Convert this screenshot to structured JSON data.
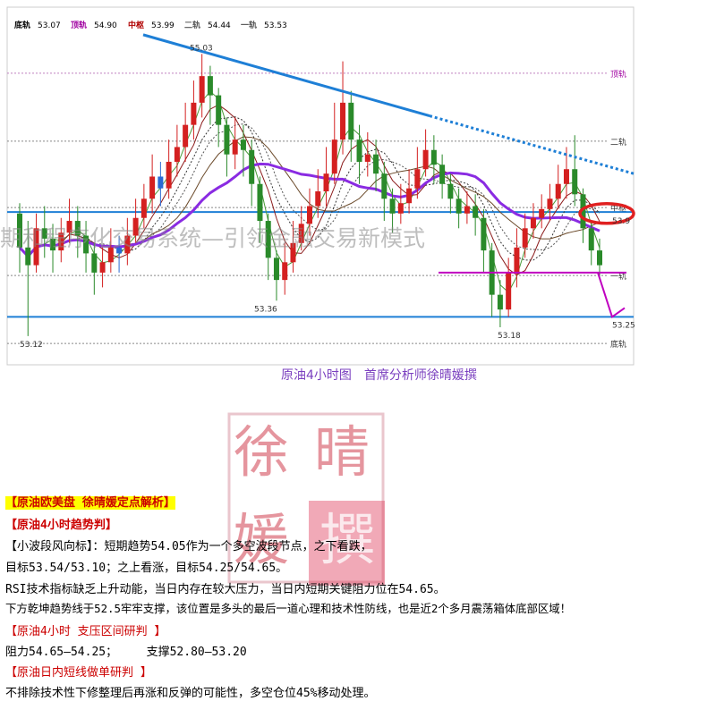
{
  "chart_data": {
    "type": "candlestick",
    "title": "原油4小时图　首席分析师徐晴媛撰",
    "indicator_bar": [
      {
        "label": "底轨",
        "value": "53.07",
        "color": "#000000"
      },
      {
        "label": "顶轨",
        "value": "54.90",
        "color": "#a000a0"
      },
      {
        "label": "中枢",
        "value": "53.99",
        "color": "#b00000"
      },
      {
        "label": "二轨",
        "value": "54.44",
        "color": "#555555"
      },
      {
        "label": "一轨",
        "value": "53.53",
        "color": "#555555"
      }
    ],
    "ylim": [
      52.95,
      55.25
    ],
    "levels": [
      {
        "name": "顶轨",
        "value": 54.9,
        "color": "#c080c0",
        "style": "dotted"
      },
      {
        "name": "二轨",
        "value": 54.44,
        "color": "#888888",
        "style": "dotted"
      },
      {
        "name": "中枢",
        "value": 53.99,
        "color": "#888888",
        "style": "dotted"
      },
      {
        "name": "一轨",
        "value": 53.53,
        "color": "#888888",
        "style": "dotted"
      },
      {
        "name": "底轨",
        "value": 53.07,
        "color": "#888888",
        "style": "dotted"
      }
    ],
    "blue_support": [
      {
        "value": 53.96
      },
      {
        "value": 53.25
      }
    ],
    "price_labels": [
      {
        "text": "55.03",
        "value": 55.03
      },
      {
        "text": "53.36",
        "value": 53.36
      },
      {
        "text": "53.18",
        "value": 53.18
      },
      {
        "text": "53.12",
        "value": 53.12
      },
      {
        "text": "53.25",
        "value": 53.25
      },
      {
        "text": "53.9",
        "value": 53.9
      }
    ],
    "candles": [
      [
        53.95,
        53.72,
        54.02,
        53.55
      ],
      [
        53.72,
        53.6,
        53.9,
        53.12
      ],
      [
        53.6,
        53.85,
        53.95,
        53.55
      ],
      [
        53.85,
        53.78,
        54.0,
        53.65
      ],
      [
        53.78,
        53.7,
        53.88,
        53.55
      ],
      [
        53.7,
        53.82,
        53.92,
        53.62
      ],
      [
        53.82,
        53.9,
        54.05,
        53.75
      ],
      [
        53.9,
        53.8,
        54.0,
        53.65
      ],
      [
        53.8,
        53.68,
        53.9,
        53.55
      ],
      [
        53.68,
        53.55,
        53.75,
        53.4
      ],
      [
        53.55,
        53.62,
        53.72,
        53.45
      ],
      [
        53.62,
        53.72,
        53.85,
        53.55
      ],
      [
        53.72,
        53.68,
        53.8,
        53.55
      ],
      [
        53.68,
        53.8,
        53.92,
        53.6
      ],
      [
        53.8,
        53.92,
        54.05,
        53.75
      ],
      [
        53.92,
        54.05,
        54.15,
        53.85
      ],
      [
        54.05,
        54.2,
        54.35,
        53.95
      ],
      [
        54.2,
        54.12,
        54.3,
        54.0
      ],
      [
        54.12,
        54.3,
        54.45,
        54.05
      ],
      [
        54.3,
        54.4,
        54.55,
        54.2
      ],
      [
        54.4,
        54.55,
        54.7,
        54.3
      ],
      [
        54.55,
        54.7,
        54.85,
        54.45
      ],
      [
        54.7,
        54.88,
        55.03,
        54.6
      ],
      [
        54.88,
        54.75,
        54.95,
        54.55
      ],
      [
        54.75,
        54.55,
        54.8,
        54.4
      ],
      [
        54.55,
        54.35,
        54.6,
        54.2
      ],
      [
        54.35,
        54.45,
        54.6,
        54.25
      ],
      [
        54.45,
        54.38,
        54.55,
        54.2
      ],
      [
        54.38,
        54.15,
        54.45,
        54.0
      ],
      [
        54.15,
        53.9,
        54.2,
        53.75
      ],
      [
        53.9,
        53.65,
        53.95,
        53.5
      ],
      [
        53.65,
        53.5,
        53.7,
        53.36
      ],
      [
        53.5,
        53.62,
        53.75,
        53.4
      ],
      [
        53.62,
        53.75,
        53.9,
        53.55
      ],
      [
        53.75,
        53.88,
        54.0,
        53.7
      ],
      [
        53.88,
        54.0,
        54.12,
        53.8
      ],
      [
        54.0,
        54.1,
        54.25,
        53.92
      ],
      [
        54.1,
        54.22,
        54.4,
        54.0
      ],
      [
        54.22,
        54.45,
        54.7,
        54.15
      ],
      [
        54.45,
        54.7,
        54.98,
        54.35
      ],
      [
        54.7,
        54.45,
        54.78,
        54.3
      ],
      [
        54.45,
        54.3,
        54.55,
        54.15
      ],
      [
        54.3,
        54.35,
        54.5,
        54.2
      ],
      [
        54.35,
        54.22,
        54.45,
        54.1
      ],
      [
        54.22,
        54.05,
        54.3,
        53.9
      ],
      [
        54.05,
        53.95,
        54.12,
        53.82
      ],
      [
        53.95,
        54.02,
        54.15,
        53.88
      ],
      [
        54.02,
        54.12,
        54.25,
        53.95
      ],
      [
        54.12,
        54.25,
        54.4,
        54.05
      ],
      [
        54.25,
        54.38,
        54.52,
        54.2
      ],
      [
        54.38,
        54.28,
        54.48,
        54.15
      ],
      [
        54.28,
        54.15,
        54.35,
        54.05
      ],
      [
        54.15,
        54.05,
        54.22,
        53.95
      ],
      [
        54.05,
        53.95,
        54.12,
        53.85
      ],
      [
        53.95,
        54.0,
        54.1,
        53.88
      ],
      [
        54.0,
        53.92,
        54.08,
        53.8
      ],
      [
        53.92,
        53.7,
        53.98,
        53.55
      ],
      [
        53.7,
        53.4,
        53.75,
        53.25
      ],
      [
        53.4,
        53.3,
        53.5,
        53.18
      ],
      [
        53.3,
        53.55,
        53.65,
        53.25
      ],
      [
        53.55,
        53.72,
        53.85,
        53.45
      ],
      [
        53.72,
        53.85,
        53.95,
        53.65
      ],
      [
        53.85,
        53.92,
        54.02,
        53.78
      ],
      [
        53.92,
        53.98,
        54.08,
        53.85
      ],
      [
        53.98,
        54.05,
        54.15,
        53.9
      ],
      [
        54.05,
        54.15,
        54.28,
        53.98
      ],
      [
        54.15,
        54.25,
        54.4,
        54.05
      ],
      [
        54.25,
        54.08,
        54.48,
        54.0
      ],
      [
        54.08,
        53.85,
        54.12,
        53.75
      ],
      [
        53.85,
        53.7,
        53.9,
        53.6
      ],
      [
        53.7,
        53.6,
        53.78,
        53.5
      ]
    ],
    "resist_trend": {
      "start_value": 55.16,
      "end_value": 54.22
    },
    "projection": {
      "from": 53.55,
      "to": 53.25
    },
    "annotation_circle_value": 53.95
  },
  "commentary": {
    "header": "【原油欧美盘 徐晴媛定点解析】",
    "trend_title": "【原油4小时趋势判】",
    "line1": "【小波段风向标】：短期趋势54.05作为一个多空波段节点，之下看跌，",
    "line2": " 目标53.54/53.10；之上看涨，目标54.25/54.65。",
    "line3": "RSI技术指标缺乏上升动能，当日内存在较大压力，当日内短期关键阻力位在54.65。",
    "line4": "下方乾坤趋势线于52.5牢牢支撑，该位置是多头的最后一道心理和技术性防线，也是近2个多月震荡箱体底部区域！",
    "range_title": "【原油4小时 支压区间研判 】",
    "range_line": "阻力54.65—54.25；　　　支撑52.80—53.20",
    "intraday_title": "【原油日内短线做单研判 】",
    "intraday_line": "不排除技术性下修整理后再涨和反弹的可能性，多空仓位45%移动处理。"
  },
  "watermark": "期和程序化交易系统—引领金融交易新模式",
  "stamp_chars": [
    "徐",
    "晴",
    "媛",
    "撰"
  ],
  "colors": {
    "accent_red": "#cc0000",
    "highlight": "#ffff00",
    "trend_blue": "#1e7fd6",
    "purple": "#8a2be2",
    "magenta": "#c000c0"
  }
}
